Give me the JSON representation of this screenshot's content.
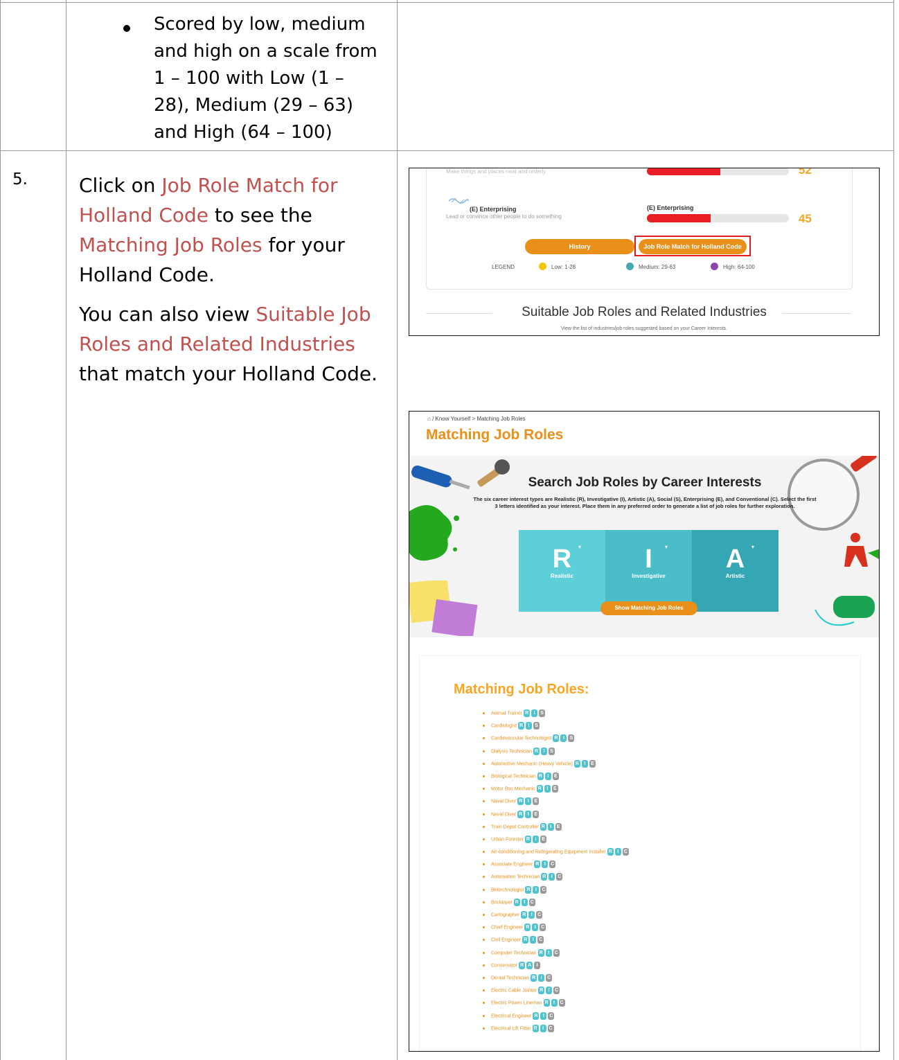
{
  "table": {
    "row_top": {
      "bullet_lines": [
        "Scored by low, medium",
        "and high on a scale from",
        "1 – 100 with Low (1 –",
        "28), Medium (29 – 63)",
        "and High (64 – 100)"
      ]
    },
    "row_5": {
      "number": "5.",
      "para1": {
        "click_on": "Click on",
        "link1_line1": "Job Role Match for",
        "link1_line2": "Holland Code",
        "to_see": "to see the",
        "link2": "Matching Job Roles",
        "for_your": "for your",
        "end": "Holland Code."
      },
      "para2": {
        "start": "You can also view",
        "link1_line1": "Suitable Job",
        "link1_line2": "Roles and Related Industries",
        "end": "that match your Holland Code."
      }
    }
  },
  "screenshot_1": {
    "top_faded_text": "Make things and places neat and orderly",
    "top_score": "52",
    "top_bar_value": 52,
    "enterprising": {
      "label": "(E) Enterprising",
      "desc": "Lead or convince other people to do something",
      "bar_label": "(E) Enterprising",
      "score": "45",
      "value": 45
    },
    "history_button": "History",
    "match_button": "Job Role Match for Holland Code",
    "legend_label": "LEGEND",
    "legend": [
      {
        "label": "Low: 1-28",
        "color": "#f5c400"
      },
      {
        "label": "Medium: 29-63",
        "color": "#45a8b0"
      },
      {
        "label": "High: 64-100",
        "color": "#8e44ad"
      }
    ],
    "section_title": "Suitable Job Roles and Related Industries",
    "section_sub": "View the list of industries/job roles suggested based on your Career Interests."
  },
  "screenshot_2": {
    "breadcrumb": "/ Know Yourself > Matching Job Roles",
    "page_title": "Matching Job Roles",
    "hero_title": "Search Job Roles by Career Interests",
    "hero_desc_1": "The six career interest types are Realistic (R), Investigative (I), Artistic (A), Social (S), Enterprising (E), and Conventional (C). Select the first",
    "hero_desc_2": "3 letters identified as your interest. Place them in any preferred order to generate a list of job roles for further exploration.",
    "tiles": [
      {
        "letter": "R",
        "name": "Realistic",
        "color": "#5ccfd9"
      },
      {
        "letter": "I",
        "name": "Investigative",
        "color": "#4abdc9"
      },
      {
        "letter": "A",
        "name": "Artistic",
        "color": "#35a6b3"
      }
    ],
    "show_button": "Show Matching Job Roles",
    "list_heading": "Matching Job Roles:",
    "jobs": [
      {
        "name": "Animal Trainer",
        "codes": [
          "R",
          "I",
          "S"
        ]
      },
      {
        "name": "Cardiologist",
        "codes": [
          "R",
          "I",
          "S"
        ]
      },
      {
        "name": "Cardiovascular Technologist",
        "codes": [
          "R",
          "I",
          "S"
        ]
      },
      {
        "name": "Dialysis Technician",
        "codes": [
          "R",
          "I",
          "S"
        ]
      },
      {
        "name": "Automotive Mechanic (Heavy Vehicle)",
        "codes": [
          "R",
          "I",
          "E"
        ]
      },
      {
        "name": "Biological Technician",
        "codes": [
          "R",
          "I",
          "E"
        ]
      },
      {
        "name": "Motor Bus Mechanic",
        "codes": [
          "R",
          "I",
          "E"
        ]
      },
      {
        "name": "Naval Diver",
        "codes": [
          "R",
          "I",
          "E"
        ]
      },
      {
        "name": "Naval Diver",
        "codes": [
          "R",
          "I",
          "E"
        ]
      },
      {
        "name": "Train Depot Controller",
        "codes": [
          "R",
          "I",
          "E"
        ]
      },
      {
        "name": "Urban Forester",
        "codes": [
          "R",
          "I",
          "E"
        ]
      },
      {
        "name": "Air-conditioning and Refrigerating Equipment Installer",
        "codes": [
          "R",
          "I",
          "C"
        ]
      },
      {
        "name": "Associate Engineer",
        "codes": [
          "R",
          "I",
          "C"
        ]
      },
      {
        "name": "Automation Technician",
        "codes": [
          "R",
          "I",
          "C"
        ]
      },
      {
        "name": "Biotechnologist",
        "codes": [
          "R",
          "I",
          "C"
        ]
      },
      {
        "name": "Bricklayer",
        "codes": [
          "R",
          "I",
          "C"
        ]
      },
      {
        "name": "Cartographer",
        "codes": [
          "R",
          "I",
          "C"
        ]
      },
      {
        "name": "Chief Engineer",
        "codes": [
          "R",
          "I",
          "C"
        ]
      },
      {
        "name": "Civil Engineer",
        "codes": [
          "R",
          "I",
          "C"
        ]
      },
      {
        "name": "Computer Technician",
        "codes": [
          "R",
          "I",
          "C"
        ]
      },
      {
        "name": "Conservator",
        "codes": [
          "R",
          "A",
          "I"
        ]
      },
      {
        "name": "Dental Technician",
        "codes": [
          "R",
          "I",
          "C"
        ]
      },
      {
        "name": "Electric Cable Jointer",
        "codes": [
          "R",
          "I",
          "C"
        ]
      },
      {
        "name": "Electric Power Lineman",
        "codes": [
          "R",
          "I",
          "C"
        ]
      },
      {
        "name": "Electrical Engineer",
        "codes": [
          "R",
          "I",
          "C"
        ]
      },
      {
        "name": "Electrical Lift Fitter",
        "codes": [
          "R",
          "I",
          "C"
        ]
      }
    ]
  }
}
